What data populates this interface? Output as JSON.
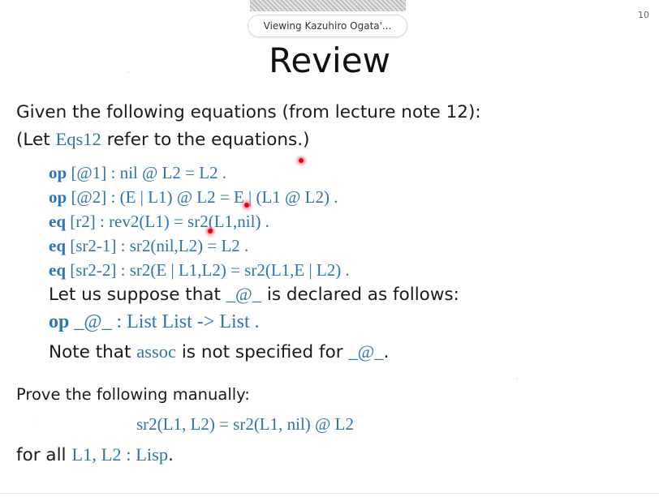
{
  "screen_share": {
    "banner": "Viewing Kazuhiro Ogata'..."
  },
  "slide": {
    "page_number": "10",
    "title": "Review",
    "intro_1": "Given the following equations (from lecture note 12):",
    "intro_2_pre": "(Let ",
    "intro_2_name": "Eqs12",
    "intro_2_post": " refer to the equations.)",
    "equations": [
      {
        "keyword": "op",
        "body": " [@1] : nil @ L2 = L2 ."
      },
      {
        "keyword": "op",
        "body": " [@2] : (E | L1) @ L2 = E | (L1 @ L2) ."
      },
      {
        "keyword": "eq",
        "body": " [r2] : rev2(L1) = sr2(L1,nil) ."
      },
      {
        "keyword": "eq",
        "body": " [sr2-1] : sr2(nil,L2) = L2 ."
      },
      {
        "keyword": "eq",
        "body": " [sr2-2] : sr2(E | L1,L2) = sr2(L1,E | L2) ."
      }
    ],
    "suppose_pre": "Let us suppose that ",
    "suppose_op": "_@_",
    "suppose_post": " is declared as follows:",
    "decl_keyword": "op",
    "decl_body": " _@_ : List List -> List .",
    "note_pre": "Note that ",
    "note_attr": "assoc",
    "note_mid": " is not specified for ",
    "note_op": "_@_",
    "note_post": ".",
    "prove_line": "Prove the following manually:",
    "goal": "sr2(L1, L2) = sr2(L1, nil) @ L2",
    "forall_pre": "for all ",
    "forall_vars": "L1, L2 : Lisp",
    "forall_post": "."
  },
  "colors": {
    "code_blue": "#2e74b5",
    "text": "#1a1a1a",
    "pointer_red": "#e0001a"
  }
}
